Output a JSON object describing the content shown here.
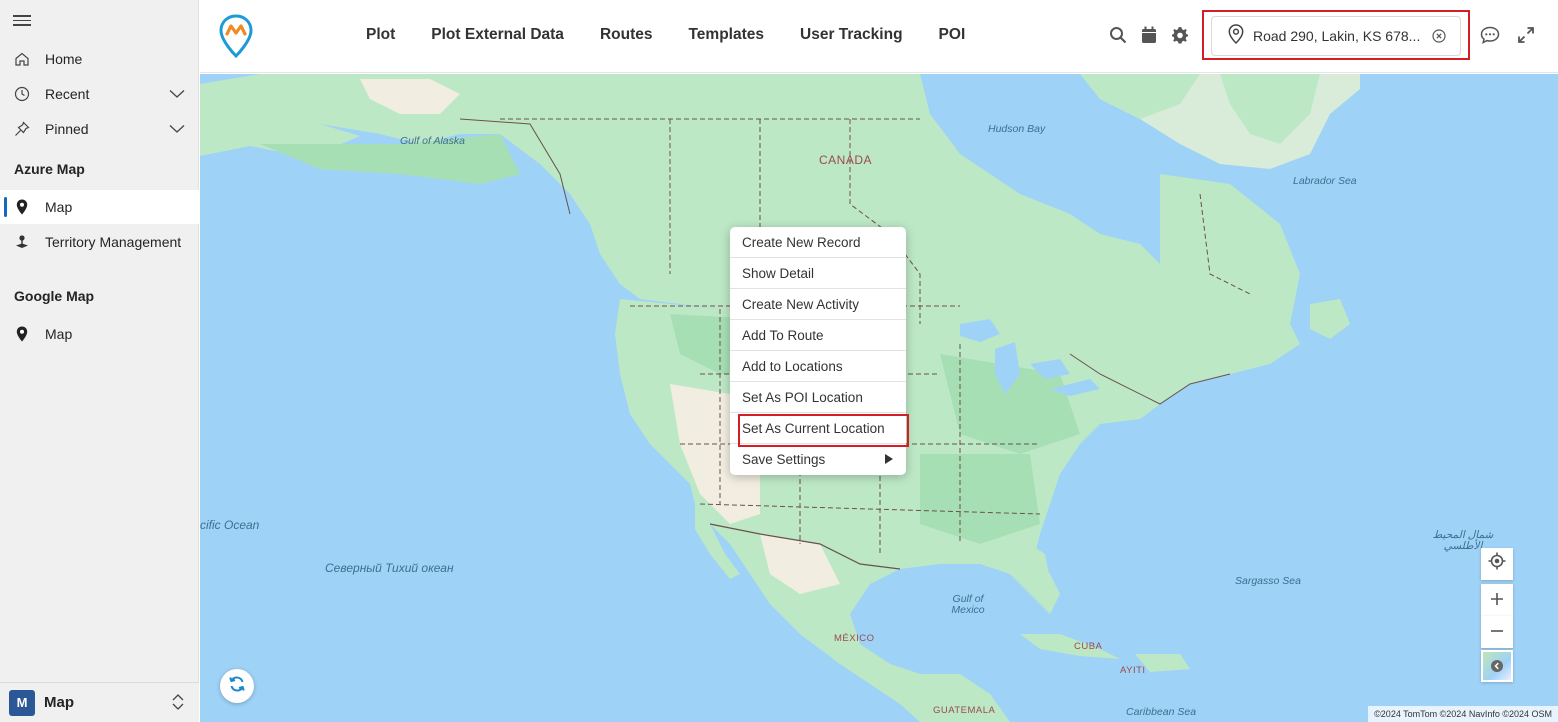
{
  "sidebar": {
    "items": [
      {
        "label": "Home",
        "icon": "home-icon"
      },
      {
        "label": "Recent",
        "icon": "clock-icon"
      },
      {
        "label": "Pinned",
        "icon": "pin-icon"
      }
    ],
    "groups": [
      {
        "title": "Azure Map",
        "items": [
          {
            "label": "Map",
            "icon": "map-marker-icon",
            "active": true
          },
          {
            "label": "Territory Management",
            "icon": "territory-icon",
            "active": false
          }
        ]
      },
      {
        "title": "Google Map",
        "items": [
          {
            "label": "Map",
            "icon": "map-marker-icon",
            "active": false
          }
        ]
      }
    ],
    "area_switcher": {
      "badge": "M",
      "label": "Map"
    }
  },
  "topbar": {
    "menu": [
      "Plot",
      "Plot External Data",
      "Routes",
      "Templates",
      "User Tracking",
      "POI"
    ],
    "tools": [
      "search-icon",
      "calendar-icon",
      "gear-icon"
    ],
    "location": {
      "value": "Road 290, Lakin, KS 678..."
    },
    "right_tools": [
      "chat-icon",
      "expand-icon"
    ]
  },
  "map": {
    "labels": {
      "canada": "CANADA",
      "mexico": "MÉXICO",
      "cuba": "CUBA",
      "haiti": "AYITI",
      "guatemala": "GUATEMALA",
      "hudson_bay": "Hudson Bay",
      "labrador_sea": "Labrador Sea",
      "gulf_of_alaska": "Gulf of Alaska",
      "pacific_ocean": "cific Ocean",
      "north_pacific_ru": "Северный Тихий океан",
      "atlantic_ar": "شمال المحيط الأطلسي",
      "sargasso_sea": "Sargasso Sea",
      "gulf_of_mexico": "Gulf of Mexico",
      "caribbean_sea": "Caribbean Sea"
    },
    "attribution": "©2024 TomTom ©2024 NavInfo ©2024 OSM",
    "colors": {
      "water": "#9fd2f7",
      "land": "#bde8c6",
      "forest": "#a7dfb4",
      "desert": "#f2ede1",
      "border": "#6b5050"
    }
  },
  "context_menu": {
    "items": [
      {
        "label": "Create New Record"
      },
      {
        "label": "Show Detail"
      },
      {
        "label": "Create New Activity"
      },
      {
        "label": "Add To Route"
      },
      {
        "label": "Add to Locations"
      },
      {
        "label": "Set As POI Location"
      },
      {
        "label": "Set As Current Location",
        "highlighted": true
      },
      {
        "label": "Save Settings",
        "submenu": true
      }
    ]
  }
}
